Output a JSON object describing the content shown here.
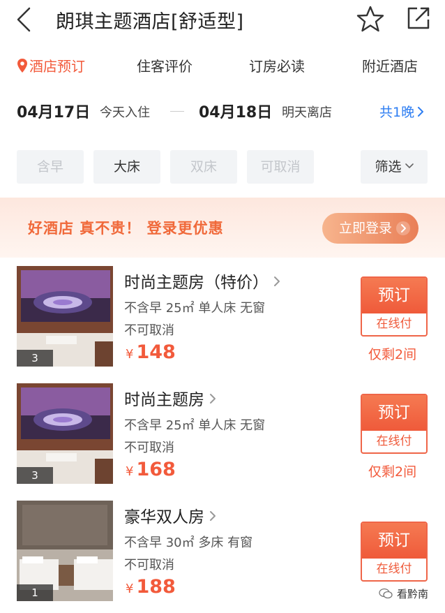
{
  "header": {
    "title": "朗琪主题酒店[舒适型]",
    "back_icon": "chevron-left-icon",
    "favorite_icon": "star-outline-icon",
    "share_icon": "share-external-icon"
  },
  "tabs": [
    {
      "label": "酒店预订",
      "active": true,
      "icon": "location-pin-icon"
    },
    {
      "label": "住客评价",
      "active": false
    },
    {
      "label": "订房必读",
      "active": false
    },
    {
      "label": "附近酒店",
      "active": false
    }
  ],
  "dates": {
    "checkin_date": "04月17日",
    "checkin_label": "今天入住",
    "checkout_date": "04月18日",
    "checkout_label": "明天离店",
    "nights": "共1晚"
  },
  "filters": [
    {
      "label": "含早",
      "enabled": false
    },
    {
      "label": "大床",
      "enabled": true
    },
    {
      "label": "双床",
      "enabled": false
    },
    {
      "label": "可取消",
      "enabled": false
    },
    {
      "label": "筛选",
      "type": "dropdown"
    }
  ],
  "promo": {
    "text": "好酒店 真不贵！ 登录更优惠",
    "button": "立即登录"
  },
  "rooms": [
    {
      "name": "时尚主题房（特价）",
      "info": "不含早 25㎡ 单人床 无窗",
      "cancel": "不可取消",
      "currency": "¥",
      "price": "148",
      "image_count": "3",
      "book_label": "预订",
      "pay_label": "在线付",
      "remaining": "仅剩2间"
    },
    {
      "name": "时尚主题房",
      "info": "不含早 25㎡ 单人床 无窗",
      "cancel": "不可取消",
      "currency": "¥",
      "price": "168",
      "image_count": "3",
      "book_label": "预订",
      "pay_label": "在线付",
      "remaining": "仅剩2间"
    },
    {
      "name": "豪华双人房",
      "info": "不含早 30㎡ 多床 有窗",
      "cancel": "不可取消",
      "currency": "¥",
      "price": "188",
      "image_count": "1",
      "book_label": "预订",
      "pay_label": "在线付",
      "remaining": ""
    }
  ],
  "watermark": "看黔南",
  "colors": {
    "accent": "#f25a3b",
    "link": "#2e7ef2",
    "chip_bg": "#f2f4f6",
    "promo_bg": "#fde7de"
  }
}
